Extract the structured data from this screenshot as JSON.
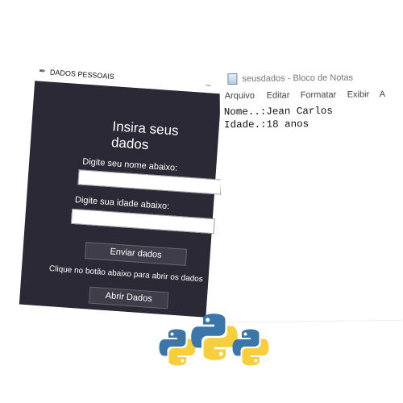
{
  "tk_window": {
    "title": "DADOS PESSOAIS",
    "heading": "Insira seus dados",
    "name_label": "Digite seu nome abaixo:",
    "name_value": "",
    "age_label": "Digite sua idade abaixo:",
    "age_value": "",
    "send_button": "Enviar dados",
    "hint": "Clique no botão abaixo para abrir os dados",
    "open_button": "Abrir Dados",
    "minimize_glyph": "_"
  },
  "notepad": {
    "title": "seusdados - Bloco de Notas",
    "menus": [
      "Arquivo",
      "Editar",
      "Formatar",
      "Exibir",
      "A"
    ],
    "lines": [
      "Nome..:Jean Carlos",
      "Idade.:18 anos"
    ]
  },
  "colors": {
    "tk_background": "#2a2935",
    "python_blue": "#3a76a9",
    "python_yellow": "#f7cf3c"
  },
  "icons": [
    "feather-icon",
    "notepad-icon",
    "python-logo"
  ]
}
